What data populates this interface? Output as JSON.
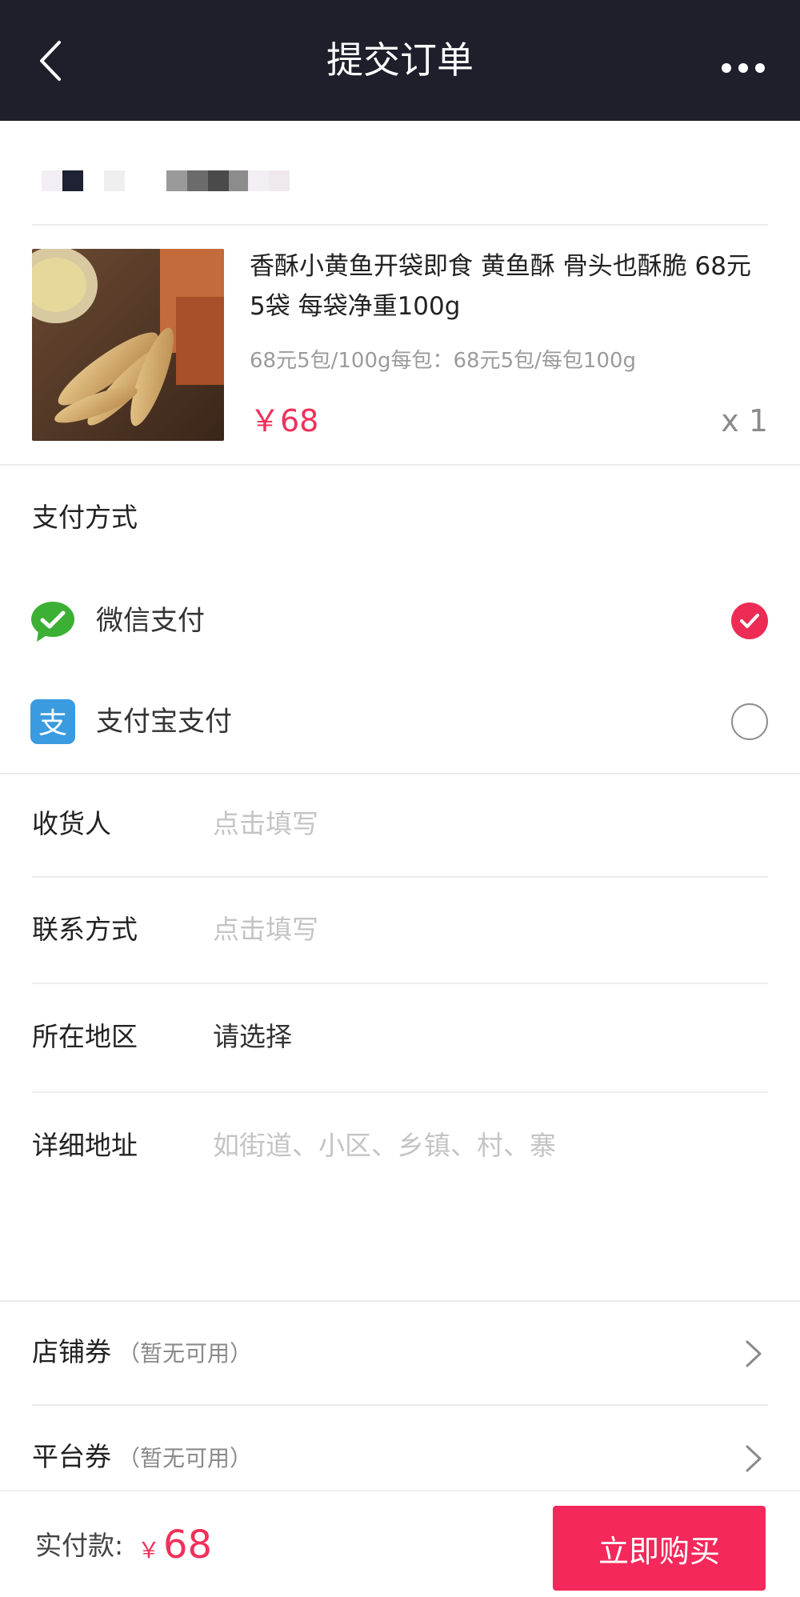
{
  "header": {
    "title": "提交订单"
  },
  "product": {
    "title": "香酥小黄鱼开袋即食 黄鱼酥 骨头也酥脆 68元5袋 每袋净重100g",
    "spec": "68元5包/100g每包：68元5包/每包100g",
    "price": "￥68",
    "quantity": "x 1"
  },
  "payment": {
    "section_title": "支付方式",
    "options": [
      {
        "label": "微信支付",
        "icon": "wechat-pay-icon",
        "selected": true
      },
      {
        "label": "支付宝支付",
        "icon": "alipay-icon",
        "selected": false
      }
    ]
  },
  "form": {
    "receiver": {
      "label": "收货人",
      "placeholder": "点击填写"
    },
    "contact": {
      "label": "联系方式",
      "placeholder": "点击填写"
    },
    "region": {
      "label": "所在地区",
      "value": "请选择"
    },
    "address": {
      "label": "详细地址",
      "placeholder": "如街道、小区、乡镇、村、寨"
    }
  },
  "coupons": {
    "shop": {
      "label": "店铺券",
      "note": "（暂无可用）"
    },
    "platform": {
      "label": "平台券",
      "note": "（暂无可用）"
    }
  },
  "footer": {
    "total_label": "实付款:",
    "currency": "￥",
    "total_amount": "68",
    "buy_label": "立即购买"
  },
  "colors": {
    "header_bg": "#1e1f2b",
    "accent": "#f4285a",
    "price": "#f0305a",
    "wechat_green": "#3cb034",
    "alipay_blue": "#3a9be0"
  }
}
